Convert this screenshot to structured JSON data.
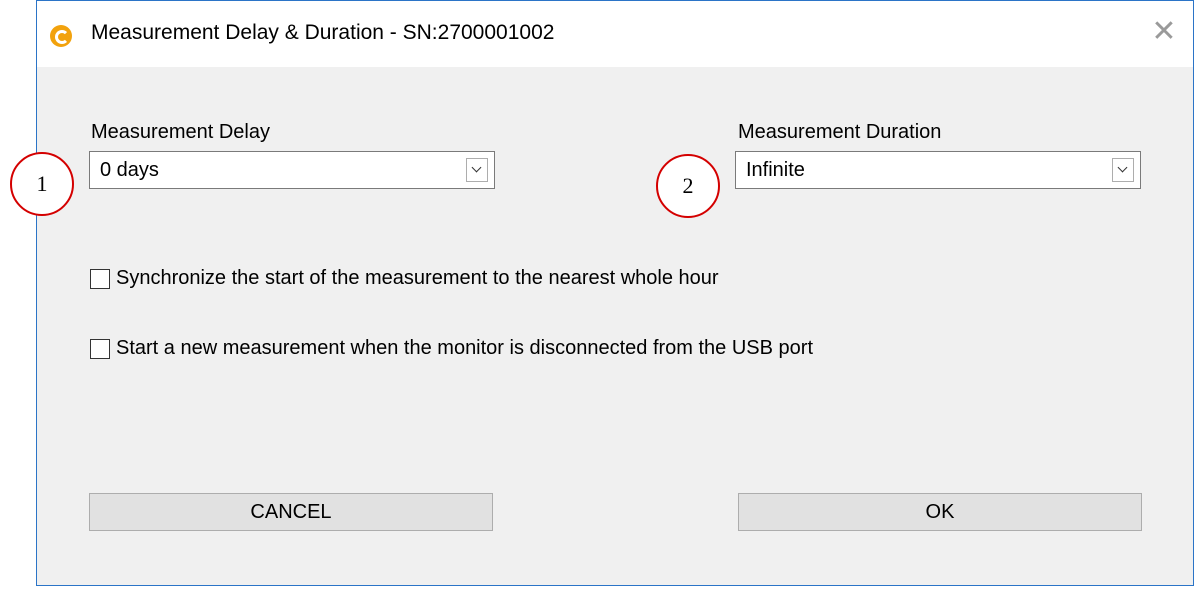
{
  "window": {
    "title": "Measurement Delay & Duration - SN:2700001002",
    "close_glyph": "✕"
  },
  "delay": {
    "label": "Measurement Delay",
    "value": "0 days"
  },
  "duration": {
    "label": "Measurement Duration",
    "value": "Infinite"
  },
  "options": [
    {
      "label": "Synchronize the start of the measurement to the nearest whole hour",
      "checked": false
    },
    {
      "label": "Start a new measurement when the monitor is disconnected from the USB port",
      "checked": false
    }
  ],
  "buttons": {
    "cancel": "CANCEL",
    "ok": "OK"
  },
  "markers": [
    "1",
    "2"
  ],
  "colors": {
    "window_border": "#2b74c7",
    "app_icon": "#f2a20d",
    "marker_outline": "#d40000"
  },
  "icons": {
    "app": "app-logo-icon",
    "close": "close-icon",
    "dropdown": "chevron-down-icon"
  }
}
